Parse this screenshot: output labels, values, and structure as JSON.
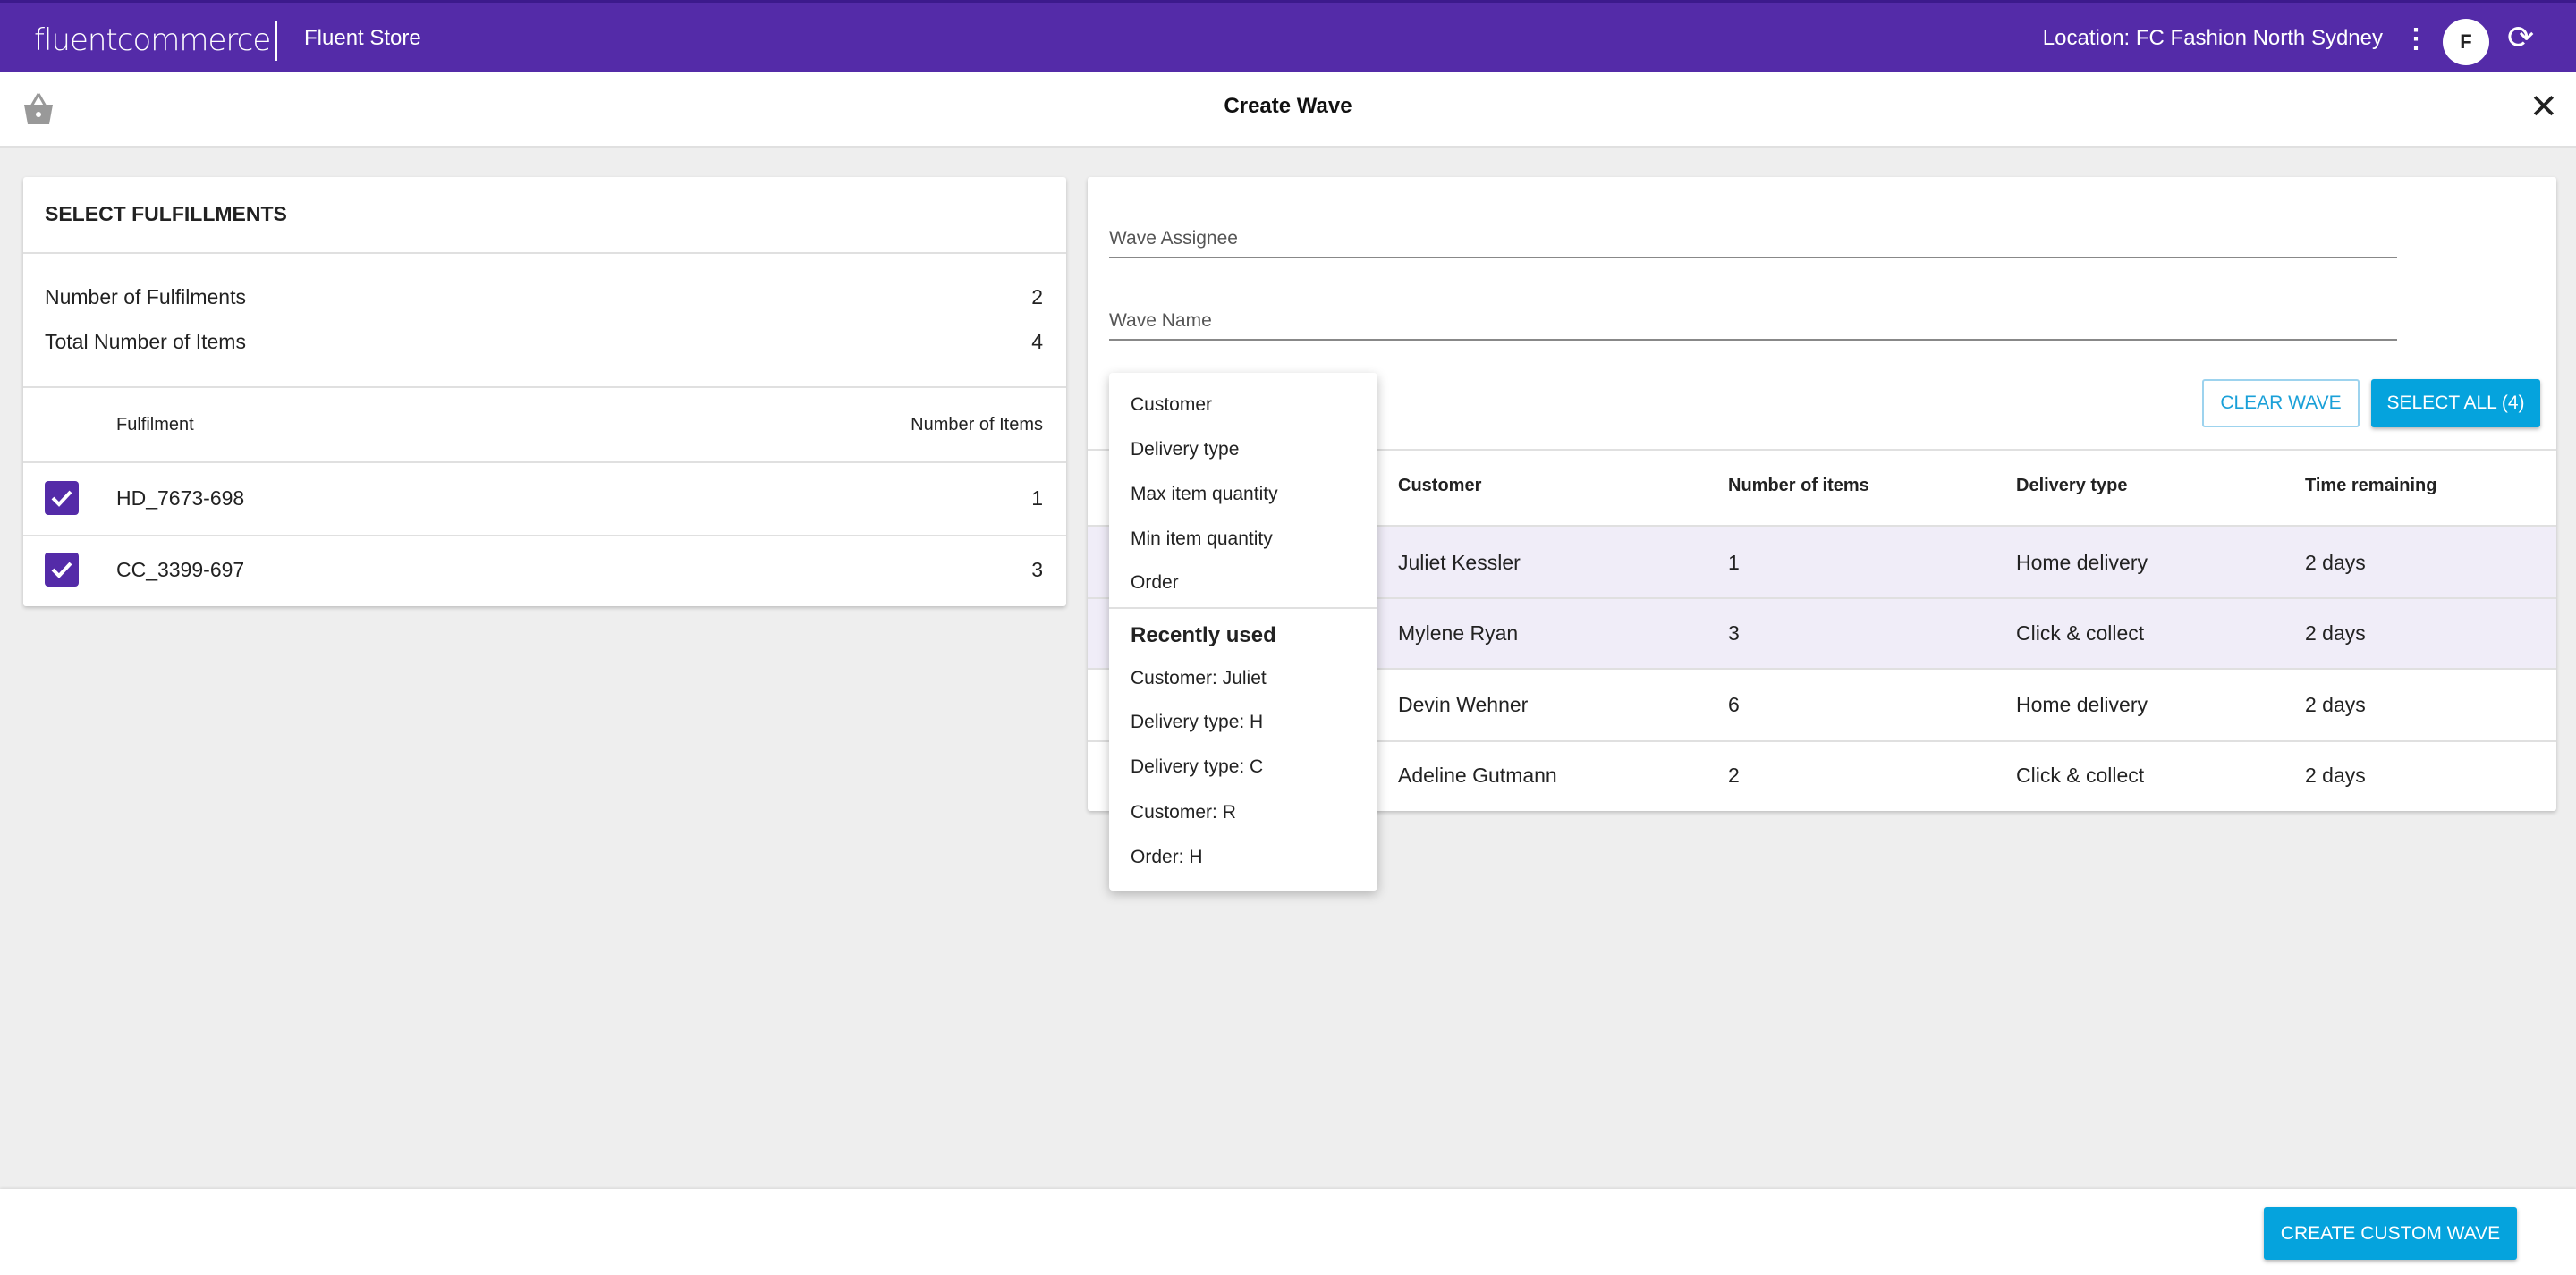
{
  "header": {
    "logo": "fluentcommerce",
    "app_name": "Fluent Store",
    "location": "Location: FC Fashion North Sydney",
    "avatar_initial": "F",
    "brand_color": "#542ba8"
  },
  "subheader": {
    "title": "Create Wave"
  },
  "left_panel": {
    "title": "SELECT FULFILLMENTS",
    "summary": [
      {
        "label": "Number of Fulfilments",
        "value": "2"
      },
      {
        "label": "Total Number of Items",
        "value": "4"
      }
    ],
    "columns": [
      "Fulfilment",
      "Number of Items"
    ],
    "rows": [
      {
        "id": "HD_7673-698",
        "items": "1",
        "checked": true
      },
      {
        "id": "CC_3399-697",
        "items": "3",
        "checked": true
      }
    ]
  },
  "right_panel": {
    "wave_assignee_label": "Wave Assignee",
    "wave_name_label": "Wave Name",
    "clear_wave": "CLEAR WAVE",
    "select_all": "SELECT ALL (4)",
    "columns": [
      "Customer",
      "Number of items",
      "Delivery type",
      "Time remaining"
    ],
    "rows": [
      {
        "customer": "Juliet Kessler",
        "items": "1",
        "delivery": "Home delivery",
        "time": "2 days",
        "selected": true
      },
      {
        "customer": "Mylene Ryan",
        "items": "3",
        "delivery": "Click & collect",
        "time": "2 days",
        "selected": true
      },
      {
        "customer": "Devin Wehner",
        "items": "6",
        "delivery": "Home delivery",
        "time": "2 days",
        "selected": false
      },
      {
        "customer": "Adeline Gutmann",
        "items": "2",
        "delivery": "Click & collect",
        "time": "2 days",
        "selected": false
      }
    ]
  },
  "dropdown": {
    "options": [
      "Customer",
      "Delivery type",
      "Max item quantity",
      "Min item quantity",
      "Order"
    ],
    "recent_heading": "Recently used",
    "recent": [
      "Customer: Juliet",
      "Delivery type: H",
      "Delivery type: C",
      "Customer: R",
      "Order: H"
    ]
  },
  "footer": {
    "create_button": "CREATE CUSTOM WAVE",
    "accent_color": "#05a3dd"
  }
}
